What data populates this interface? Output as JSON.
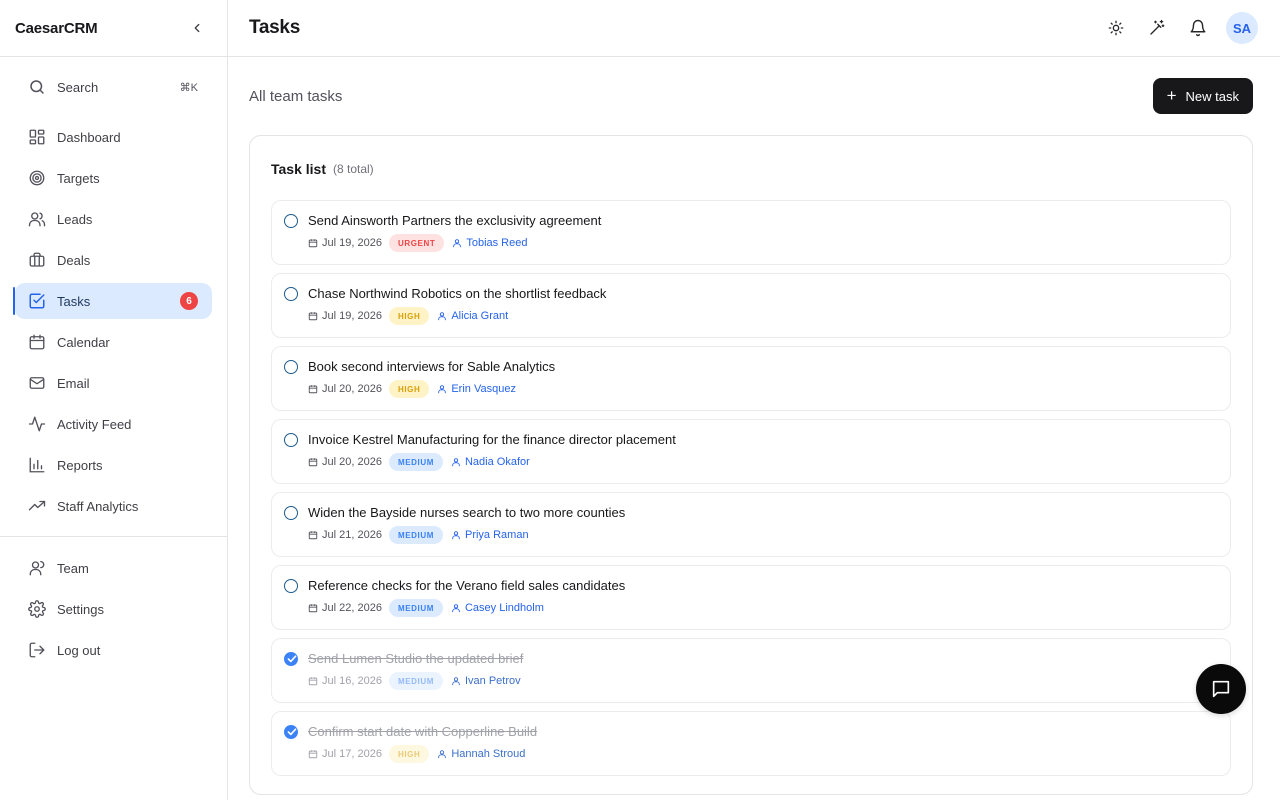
{
  "brand": {
    "name": "CaesarCRM"
  },
  "search": {
    "label": "Search",
    "shortcut": "⌘K"
  },
  "nav": {
    "primary": [
      {
        "label": "Dashboard",
        "icon": "dashboard-icon"
      },
      {
        "label": "Targets",
        "icon": "target-icon"
      },
      {
        "label": "Leads",
        "icon": "users-icon"
      },
      {
        "label": "Deals",
        "icon": "briefcase-icon"
      },
      {
        "label": "Tasks",
        "icon": "check-square-icon",
        "badge": "6",
        "active": true
      },
      {
        "label": "Calendar",
        "icon": "calendar-icon"
      },
      {
        "label": "Email",
        "icon": "mail-icon"
      },
      {
        "label": "Activity Feed",
        "icon": "activity-icon"
      },
      {
        "label": "Reports",
        "icon": "bar-chart-icon"
      },
      {
        "label": "Staff Analytics",
        "icon": "trending-up-icon"
      }
    ],
    "secondary": [
      {
        "label": "Team",
        "icon": "user-icon"
      },
      {
        "label": "Settings",
        "icon": "gear-icon"
      },
      {
        "label": "Log out",
        "icon": "logout-icon"
      }
    ]
  },
  "header": {
    "title": "Tasks",
    "avatar_initials": "SA"
  },
  "main": {
    "subtitle": "All team tasks",
    "new_task_label": "New task",
    "card_title": "Task list",
    "card_count": "(8 total)"
  },
  "tasks": [
    {
      "title": "Send Ainsworth Partners the exclusivity agreement",
      "due": "Jul 19, 2026",
      "priority": "URGENT",
      "assignee": "Tobias Reed",
      "done": false
    },
    {
      "title": "Chase Northwind Robotics on the shortlist feedback",
      "due": "Jul 19, 2026",
      "priority": "HIGH",
      "assignee": "Alicia Grant",
      "done": false
    },
    {
      "title": "Book second interviews for Sable Analytics",
      "due": "Jul 20, 2026",
      "priority": "HIGH",
      "assignee": "Erin Vasquez",
      "done": false
    },
    {
      "title": "Invoice Kestrel Manufacturing for the finance director placement",
      "due": "Jul 20, 2026",
      "priority": "MEDIUM",
      "assignee": "Nadia Okafor",
      "done": false
    },
    {
      "title": "Widen the Bayside nurses search to two more counties",
      "due": "Jul 21, 2026",
      "priority": "MEDIUM",
      "assignee": "Priya Raman",
      "done": false
    },
    {
      "title": "Reference checks for the Verano field sales candidates",
      "due": "Jul 22, 2026",
      "priority": "MEDIUM",
      "assignee": "Casey Lindholm",
      "done": false
    },
    {
      "title": "Send Lumen Studio the updated brief",
      "due": "Jul 16, 2026",
      "priority": "MEDIUM",
      "assignee": "Ivan Petrov",
      "done": true
    },
    {
      "title": "Confirm start date with Copperline Build",
      "due": "Jul 17, 2026",
      "priority": "HIGH",
      "assignee": "Hannah Stroud",
      "done": true
    }
  ],
  "colors": {
    "accent": "#2563eb",
    "active_bg": "#dbeafe",
    "badge": "#ef4444",
    "urgent": "#ef4444",
    "high": "#d9a006",
    "medium": "#3b82f6",
    "primary_button": "#18181b"
  }
}
